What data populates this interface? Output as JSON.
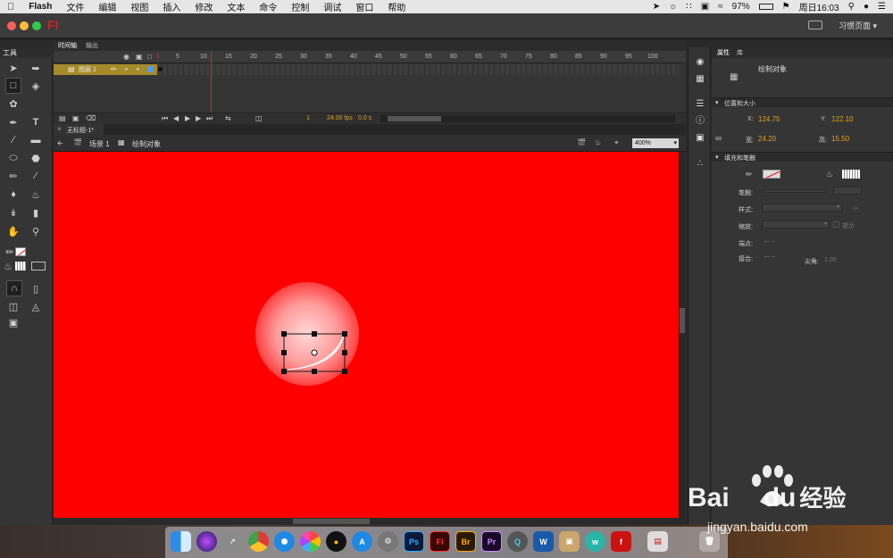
{
  "menubar": {
    "app_name": "Flash",
    "items": [
      "文件",
      "编辑",
      "视图",
      "插入",
      "修改",
      "文本",
      "命令",
      "控制",
      "调试",
      "窗口",
      "帮助"
    ],
    "battery": "97%",
    "clock": "周日16:03"
  },
  "window": {
    "logo": "Fl",
    "workspace_label": "习惯页面",
    "traffic_colors": [
      "#fc605b",
      "#fdbc40",
      "#34c84a"
    ]
  },
  "tools_panel": {
    "title": "工具"
  },
  "timeline": {
    "tabs": [
      "时间轴",
      "输出"
    ],
    "frame_numbers": [
      "1",
      "5",
      "10",
      "15",
      "20",
      "25",
      "30",
      "35",
      "40",
      "45",
      "50",
      "55",
      "60",
      "65",
      "70",
      "75",
      "80",
      "85",
      "90",
      "95",
      "100"
    ],
    "layer_name": "图层 1",
    "current_frame": "1",
    "fps": "24.00 fps",
    "time": "0.0 s"
  },
  "document": {
    "tab_label": "无标题-1*",
    "scene_label": "场景 1",
    "object_label": "绘制对象",
    "zoom": "400%",
    "stage_color": "#ff0000"
  },
  "properties": {
    "tabs": [
      "属性",
      "库"
    ],
    "object_type": "绘制对象",
    "position_section": "位置和大小",
    "x_label": "X:",
    "x_value": "124.75",
    "y_label": "Y:",
    "y_value": "122.10",
    "w_label": "宽:",
    "w_value": "24.20",
    "h_label": "高:",
    "h_value": "15.50",
    "fill_section": "填充和笔触",
    "stroke_label": "笔触:",
    "style_label": "样式:",
    "scale_label": "缩放:",
    "hint_label": "提示",
    "cap_label": "端点:",
    "join_label": "接合:",
    "miter_label": "尖角:",
    "miter_value": "1.00"
  },
  "dock": {
    "apps": [
      "finder-icon",
      "siri-icon",
      "launchpad-icon",
      "chrome-icon",
      "safari-icon",
      "photos-icon",
      "qq-icon",
      "appstore-icon",
      "preferences-icon",
      "photoshop-icon",
      "flash-icon",
      "bridge-icon",
      "premiere-icon",
      "quicktime-icon",
      "word-icon",
      "archive-icon",
      "wunderlist-icon",
      "flashplayer-icon",
      "screens-icon",
      "trash-icon"
    ],
    "labels": [
      "Ps",
      "Fl",
      "Br",
      "Pr",
      "W"
    ]
  },
  "watermark": {
    "brand": "Bai",
    "brand2": "du",
    "suffix": "经验",
    "url": "jingyan.baidu.com"
  }
}
